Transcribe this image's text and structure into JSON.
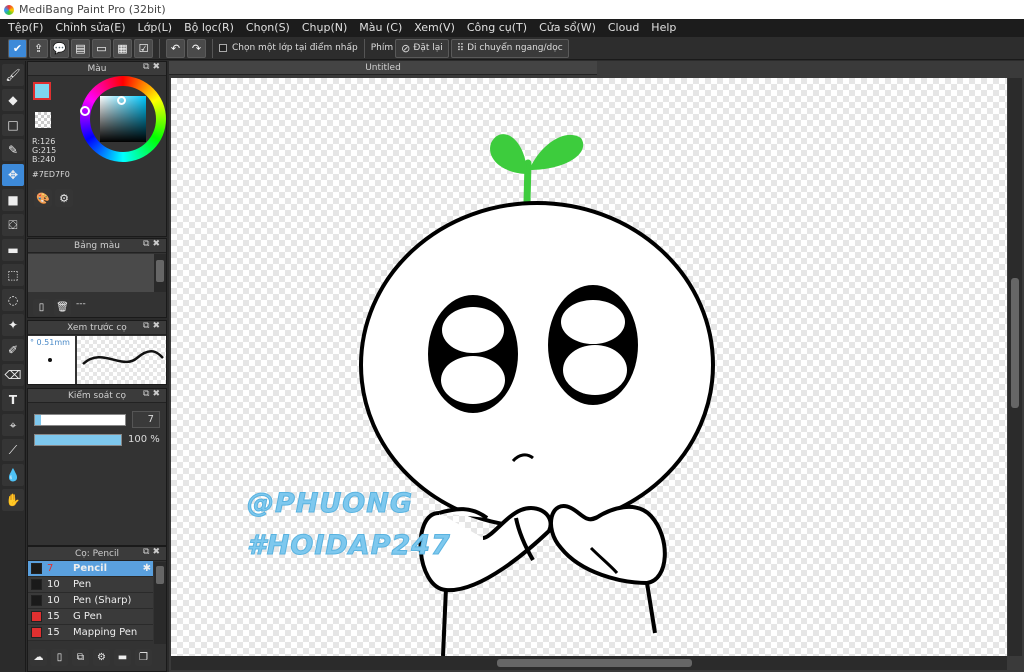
{
  "window": {
    "title": "MediBang Paint Pro (32bit)"
  },
  "menu": [
    "Tệp(F)",
    "Chỉnh sửa(E)",
    "Lớp(L)",
    "Bộ lọc(R)",
    "Chọn(S)",
    "Chụp(N)",
    "Màu (C)",
    "Xem(V)",
    "Công cụ(T)",
    "Cửa sổ(W)",
    "Cloud",
    "Help"
  ],
  "toolbar": {
    "select_layer_label": "Chọn một lớp tại điểm nhấp",
    "key_label": "Phím",
    "reset_label": "Đặt lại",
    "move_label": "Di chuyển ngang/dọc"
  },
  "color_panel": {
    "title": "Màu",
    "r": "R:126",
    "g": "G:215",
    "b": "B:240",
    "hex": "#7ED7F0",
    "color": "#7ed7f0"
  },
  "palette_panel": {
    "title": "Bảng màu",
    "footer": "---"
  },
  "brush_preview": {
    "title": "Xem trước cọ",
    "size": "0.51mm"
  },
  "brush_control": {
    "title": "Kiểm soát cọ",
    "size_value": "7",
    "opacity_value": "100 %",
    "size_fraction": 0.07,
    "opacity_fraction": 1.0
  },
  "brush_list": {
    "title": "Cọ: Pencil",
    "items": [
      {
        "size": "7",
        "name": "Pencil",
        "color": "#1a1a1a"
      },
      {
        "size": "10",
        "name": "Pen",
        "color": "#1a1a1a"
      },
      {
        "size": "10",
        "name": "Pen (Sharp)",
        "color": "#1a1a1a"
      },
      {
        "size": "15",
        "name": "G Pen",
        "color": "#e03030"
      },
      {
        "size": "15",
        "name": "Mapping Pen",
        "color": "#e03030"
      }
    ]
  },
  "document": {
    "tab": "Untitled"
  },
  "watermark": {
    "line1": "@PHUONG",
    "line2": "#HOIDAP247"
  },
  "colors": {
    "accent": "#3d8ad9",
    "sprout": "#3dcc3d",
    "watermark": "#7ec8ee"
  }
}
